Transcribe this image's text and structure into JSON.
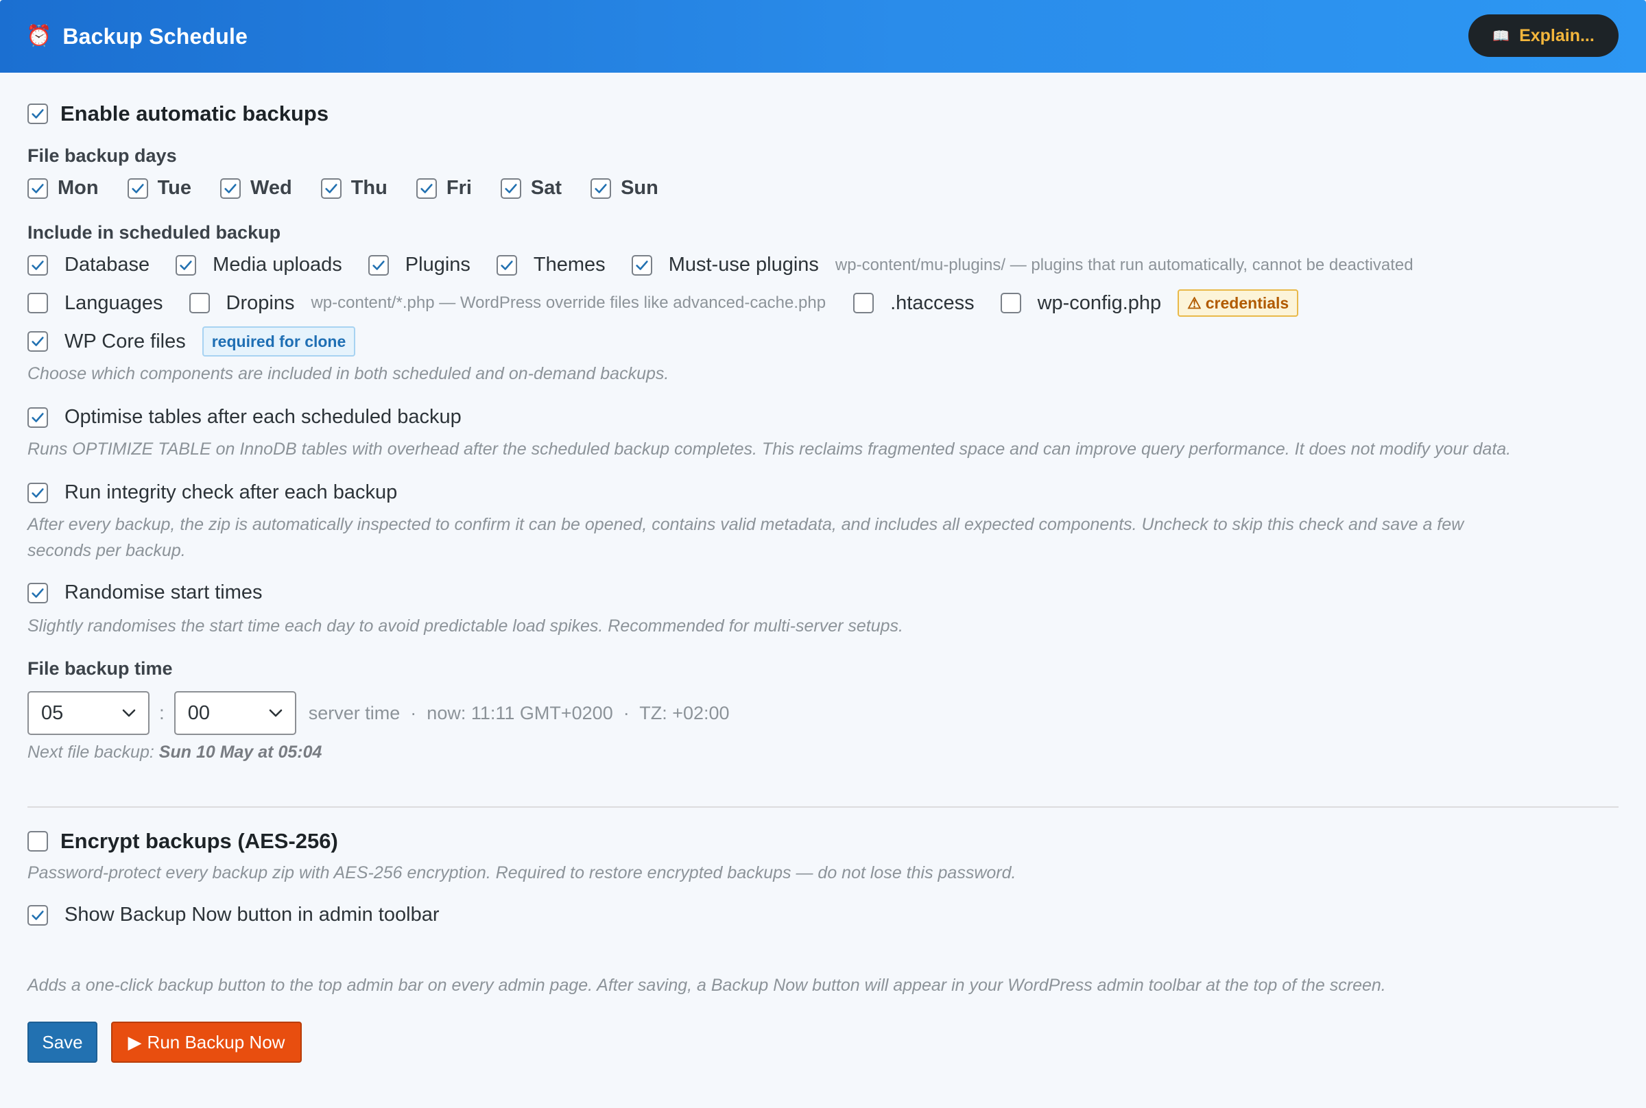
{
  "header": {
    "icon": "alarm-clock-icon",
    "title": "Backup Schedule",
    "explain_icon": "open-book-icon",
    "explain_label": "Explain..."
  },
  "enable": {
    "label": "Enable automatic backups",
    "checked": true
  },
  "days": {
    "heading": "File backup days",
    "items": [
      {
        "label": "Mon",
        "checked": true
      },
      {
        "label": "Tue",
        "checked": true
      },
      {
        "label": "Wed",
        "checked": true
      },
      {
        "label": "Thu",
        "checked": true
      },
      {
        "label": "Fri",
        "checked": true
      },
      {
        "label": "Sat",
        "checked": true
      },
      {
        "label": "Sun",
        "checked": true
      }
    ]
  },
  "include": {
    "heading": "Include in scheduled backup",
    "database": {
      "label": "Database",
      "checked": true
    },
    "media": {
      "label": "Media uploads",
      "checked": true
    },
    "plugins": {
      "label": "Plugins",
      "checked": true
    },
    "themes": {
      "label": "Themes",
      "checked": true
    },
    "mu_plugins": {
      "label": "Must-use plugins",
      "checked": true,
      "hint": "wp-content/mu-plugins/ — plugins that run automatically, cannot be deactivated"
    },
    "languages": {
      "label": "Languages",
      "checked": false
    },
    "dropins": {
      "label": "Dropins",
      "checked": false,
      "hint": "wp-content/*.php — WordPress override files like advanced-cache.php"
    },
    "htaccess": {
      "label": ".htaccess",
      "checked": false
    },
    "wpconfig": {
      "label": "wp-config.php",
      "checked": false,
      "badge": "credentials",
      "badge_icon": "warning-icon"
    },
    "core": {
      "label": "WP Core files",
      "checked": true,
      "badge": "required for clone"
    },
    "help": "Choose which components are included in both scheduled and on-demand backups."
  },
  "optimise": {
    "label": "Optimise tables after each scheduled backup",
    "checked": true,
    "help": "Runs OPTIMIZE TABLE on InnoDB tables with overhead after the scheduled backup completes. This reclaims fragmented space and can improve query performance. It does not modify your data."
  },
  "integrity": {
    "label": "Run integrity check after each backup",
    "checked": true,
    "help_line1": "After every backup, the zip is automatically inspected to confirm it can be opened, contains valid metadata, and includes all expected components. Uncheck to skip this check and save a few",
    "help_line2": "seconds per backup."
  },
  "randomise": {
    "label": "Randomise start times",
    "checked": true,
    "help": "Slightly randomises the start time each day to avoid predictable load spikes. Recommended for multi-server setups."
  },
  "time": {
    "heading": "File backup time",
    "hour": "05",
    "separator": ":",
    "minute": "00",
    "info": "server time  ·  now: 11:11 GMT+0200  ·  TZ: +02:00",
    "next_label": "Next file backup:",
    "next_value": "Sun 10 May at 05:04"
  },
  "encrypt": {
    "label": "Encrypt backups (AES-256)",
    "checked": false,
    "help": "Password-protect every backup zip with AES-256 encryption. Required to restore encrypted backups — do not lose this password."
  },
  "toolbar": {
    "label": "Show Backup Now button in admin toolbar",
    "checked": true,
    "help": "Adds a one-click backup button to the top admin bar on every admin page. After saving, a Backup Now button will appear in your WordPress admin toolbar at the top of the screen."
  },
  "actions": {
    "save_label": "Save",
    "run_icon": "play-icon",
    "run_label": "Run Backup Now"
  },
  "colors": {
    "header_start": "#1b6fd1",
    "header_end": "#2d97f3",
    "accent_check": "#2271b1",
    "save_button": "#2271b1",
    "run_button": "#e84e0f",
    "explain_text": "#f3b63c"
  }
}
